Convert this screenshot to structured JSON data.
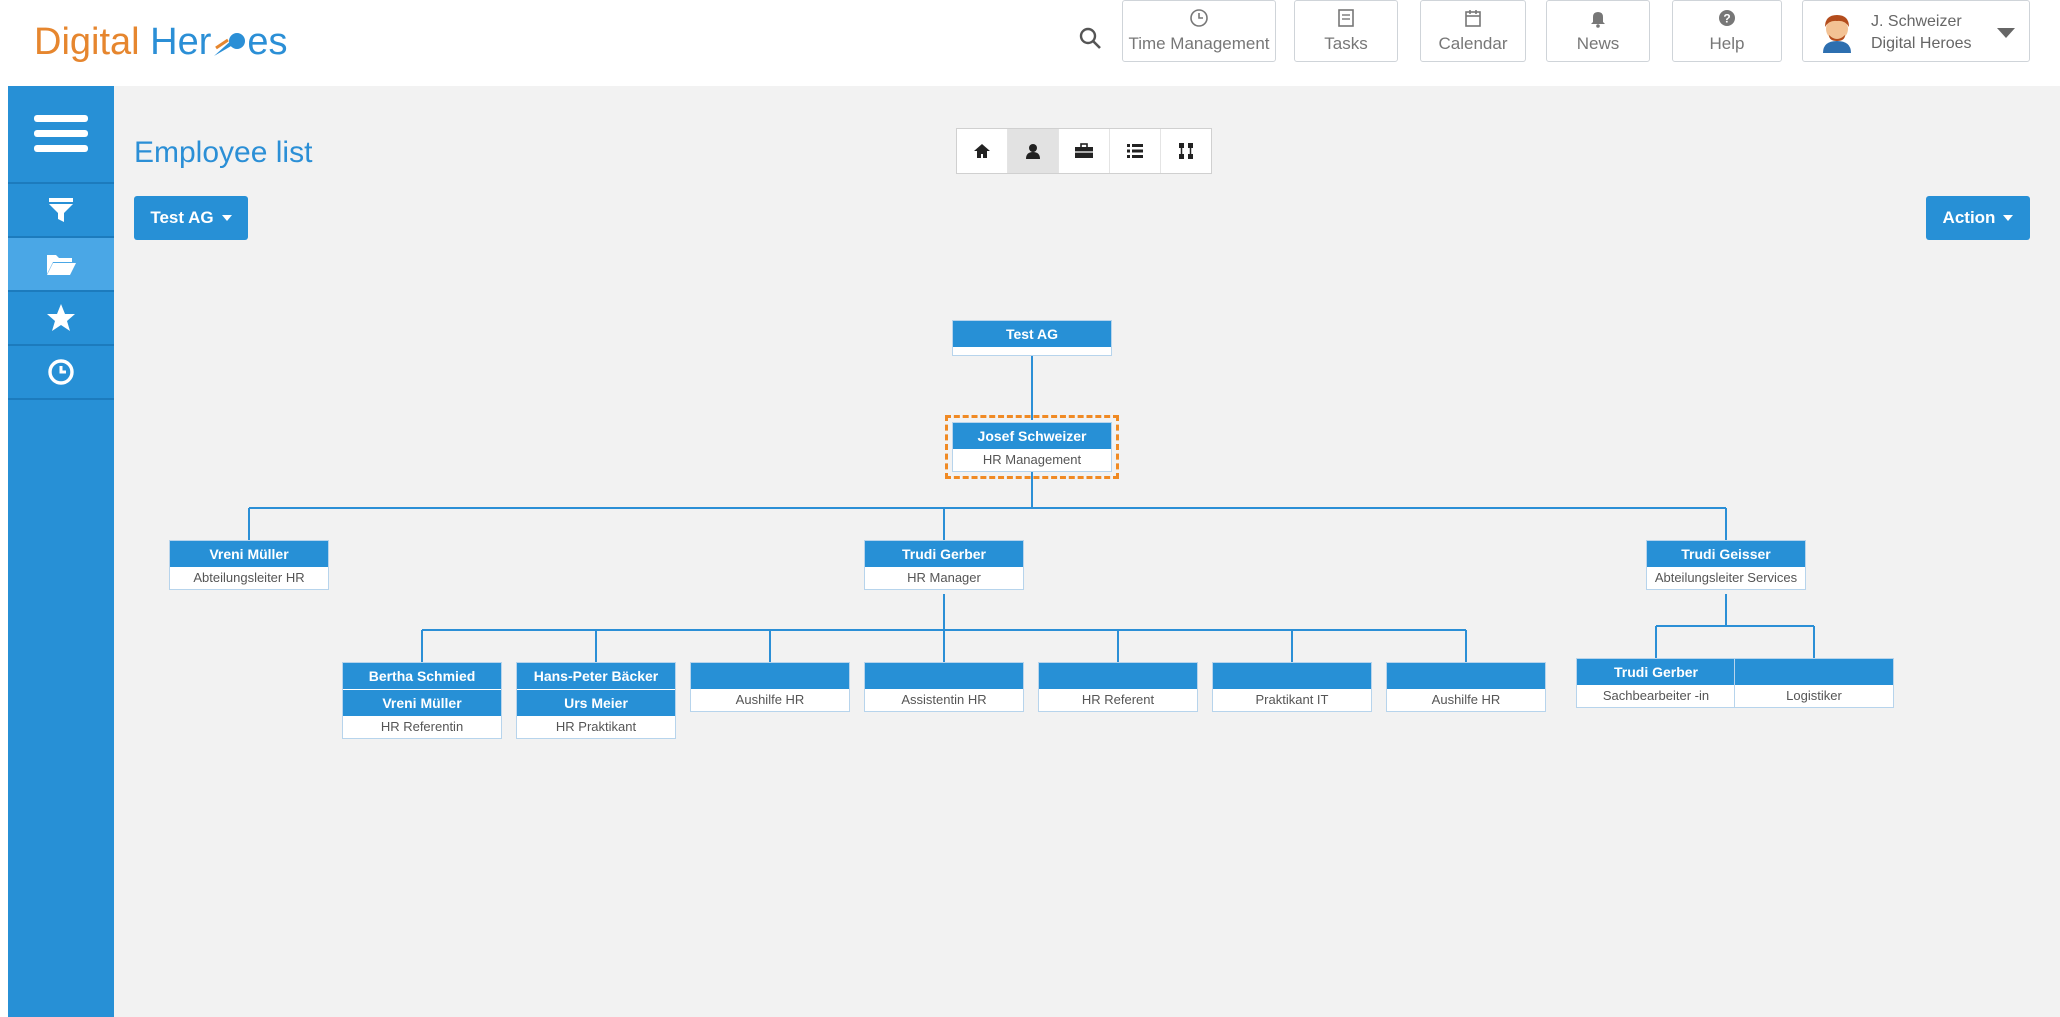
{
  "header": {
    "logo": {
      "part1": "Digital",
      "part2": "Her",
      "part3": "es"
    },
    "nav": [
      {
        "label": "Time Management",
        "icon": "clock-icon"
      },
      {
        "label": "Tasks",
        "icon": "tasks-icon"
      },
      {
        "label": "Calendar",
        "icon": "calendar-icon"
      },
      {
        "label": "News",
        "icon": "bell-icon"
      },
      {
        "label": "Help",
        "icon": "help-icon"
      }
    ],
    "user": {
      "name": "J. Schweizer",
      "company": "Digital Heroes"
    }
  },
  "sidebar": {
    "items": [
      {
        "icon": "menu-icon"
      },
      {
        "icon": "filter-icon"
      },
      {
        "icon": "folder-open-icon"
      },
      {
        "icon": "star-icon"
      },
      {
        "icon": "clock-icon"
      }
    ]
  },
  "page": {
    "title": "Employee list",
    "company_select": "Test AG",
    "action_button": "Action",
    "view_buttons": [
      "home-icon",
      "person-icon",
      "briefcase-icon",
      "list-icon",
      "hierarchy-icon"
    ]
  },
  "org": {
    "root": {
      "title": "Test AG"
    },
    "head": {
      "name": "Josef Schweizer",
      "role": "HR Management"
    },
    "level1": [
      {
        "name": "Vreni Müller",
        "role": "Abteilungsleiter HR"
      },
      {
        "name": "Trudi Gerber",
        "role": "HR Manager"
      },
      {
        "name": "Trudi Geisser",
        "role": "Abteilungsleiter Services"
      }
    ],
    "level2_manager": [
      {
        "names": [
          "Bertha Schmied",
          "Vreni Müller"
        ],
        "role": "HR Referentin"
      },
      {
        "names": [
          "Hans-Peter Bäcker",
          "Urs Meier"
        ],
        "role": "HR Praktikant"
      },
      {
        "names": [
          ""
        ],
        "role": "Aushilfe HR"
      },
      {
        "names": [
          ""
        ],
        "role": "Assistentin HR"
      },
      {
        "names": [
          ""
        ],
        "role": "HR Referent"
      },
      {
        "names": [
          ""
        ],
        "role": "Praktikant IT"
      },
      {
        "names": [
          ""
        ],
        "role": "Aushilfe HR"
      }
    ],
    "level2_services": [
      {
        "names": [
          "Trudi Gerber"
        ],
        "role": "Sachbearbeiter -in"
      },
      {
        "names": [
          ""
        ],
        "role": "Logistiker"
      }
    ]
  }
}
